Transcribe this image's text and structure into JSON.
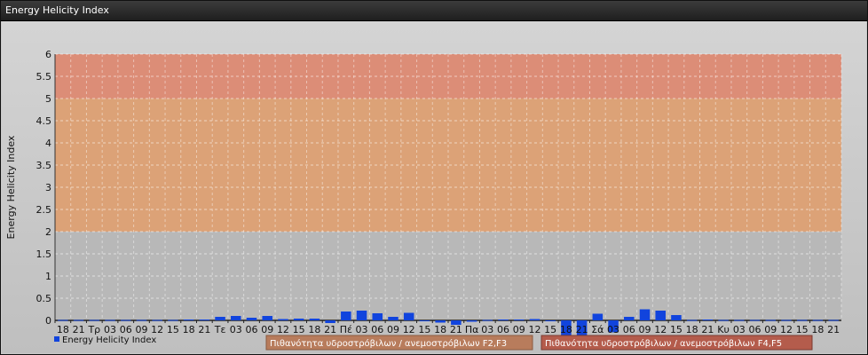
{
  "window": {
    "title": "Energy Helicity Index"
  },
  "chart_data": {
    "type": "bar",
    "ylabel": "Energy Helicity Index",
    "xlabel": "",
    "ylim": [
      0,
      6
    ],
    "yticks": [
      "0",
      "0.5",
      "1",
      "1.5",
      "2",
      "2.5",
      "3",
      "3.5",
      "4",
      "4.5",
      "5",
      "5.5",
      "6"
    ],
    "grid": true,
    "bands": [
      {
        "from": 2,
        "to": 5,
        "color": "#e0a070"
      },
      {
        "from": 5,
        "to": 6,
        "color": "#e08870"
      }
    ],
    "categories": [
      "18",
      "21",
      "Τρ",
      "03",
      "06",
      "09",
      "12",
      "15",
      "18",
      "21",
      "Τε",
      "03",
      "06",
      "09",
      "12",
      "15",
      "18",
      "21",
      "Πέ",
      "03",
      "06",
      "09",
      "12",
      "15",
      "18",
      "21",
      "Πα",
      "03",
      "06",
      "09",
      "12",
      "15",
      "18",
      "21",
      "Σά",
      "03",
      "06",
      "09",
      "12",
      "15",
      "18",
      "21",
      "Κυ",
      "03",
      "06",
      "09",
      "12",
      "15",
      "18",
      "21"
    ],
    "series": [
      {
        "name": "Energy Helicity Index",
        "color": "#1144dd",
        "values": [
          0.01,
          0.01,
          0.01,
          0.01,
          0.01,
          0.01,
          0.01,
          0.01,
          0.02,
          0.02,
          0.08,
          0.1,
          0.06,
          0.1,
          0.03,
          0.04,
          0.04,
          -0.06,
          0.2,
          0.22,
          0.16,
          0.08,
          0.17,
          -0.02,
          -0.05,
          -0.1,
          -0.03,
          0.01,
          0.02,
          0.02,
          0.03,
          -0.02,
          -0.5,
          -0.35,
          0.15,
          -0.27,
          0.08,
          0.25,
          0.22,
          0.12,
          0.01,
          0.02,
          0.01,
          0.01,
          0.01,
          0.01,
          0.01,
          0.01,
          0.01,
          0.01
        ]
      }
    ],
    "legend": [
      {
        "label": "Energy Helicity Index",
        "marker": "square",
        "color": "#1144dd"
      },
      {
        "label": "Πιθανότητα υδροστρόβιλων / ανεμοστρόβιλων F2,F3",
        "color": "#b87c5c"
      },
      {
        "label": "Πιθανότητα υδροστρόβιλων / ανεμοστρόβιλων F4,F5",
        "color": "#b45c4c"
      }
    ],
    "legend_position": "bottom"
  }
}
